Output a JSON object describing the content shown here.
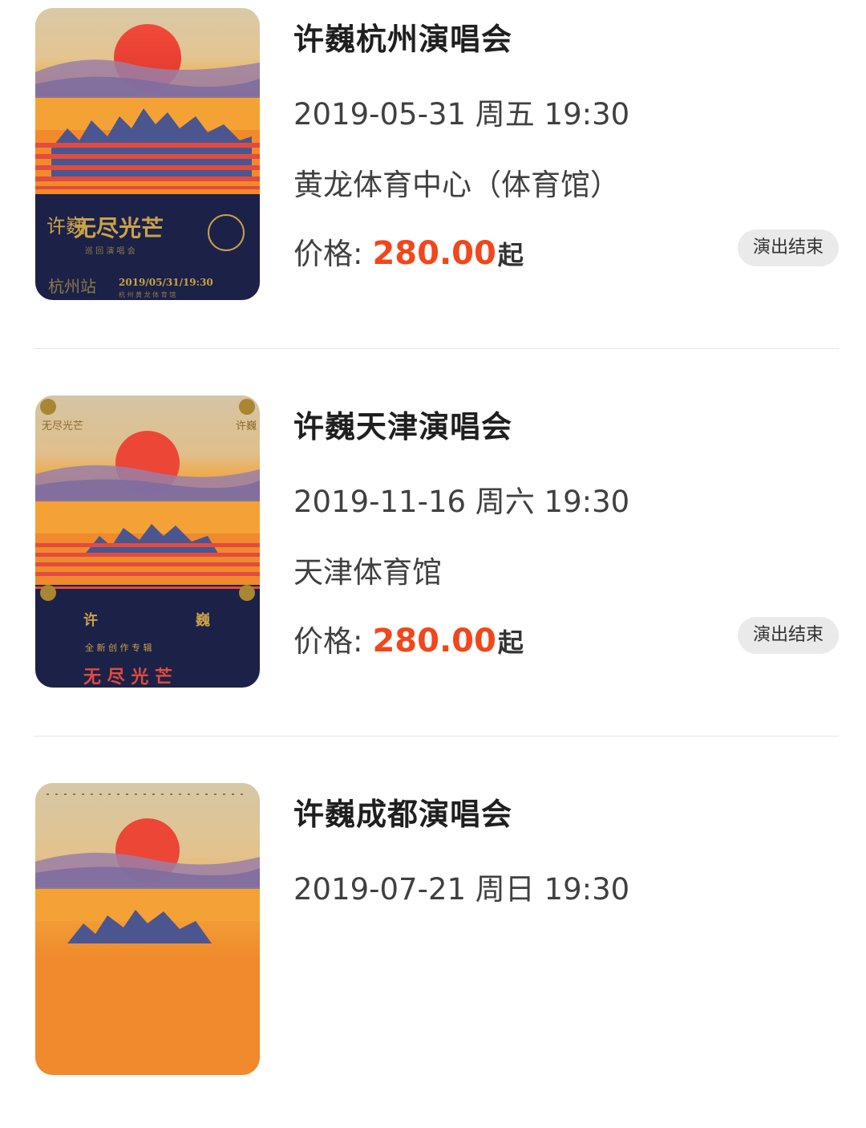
{
  "concerts": [
    {
      "title": "许巍杭州演唱会",
      "datetime": "2019-05-31 周五 19:30",
      "venue": "黄龙体育中心（体育馆）",
      "price_label": "价格:",
      "price_value": "280.00",
      "price_suffix": "起",
      "status": "演出结束",
      "poster": {
        "name_vertical": "许巍",
        "tour_title": "无尽光芒",
        "sub": "巡 回 演 唱 会",
        "station": "杭州站",
        "date": "2019/05/31/19:30",
        "venue_line": "杭 州 黄 龙 体 育 馆"
      }
    },
    {
      "title": "许巍天津演唱会",
      "datetime": "2019-11-16 周六 19:30",
      "venue": "天津体育馆",
      "price_label": "价格:",
      "price_value": "280.00",
      "price_suffix": "起",
      "status": "演出结束",
      "poster": {
        "corner_left": "无尽光芒",
        "corner_right": "许巍",
        "name_left": "许",
        "name_right": "巍",
        "sub": "全 新 创 作 专 辑",
        "tour_title": "无 尽 光 芒"
      }
    },
    {
      "title": "许巍成都演唱会",
      "datetime": "2019-07-21 周日 19:30"
    }
  ],
  "colors": {
    "price": "#f2461b",
    "badge_bg": "#eaeaea",
    "divider": "#e6e6e6",
    "poster_navy": "#1c2147",
    "poster_gold": "#c9a24a"
  }
}
